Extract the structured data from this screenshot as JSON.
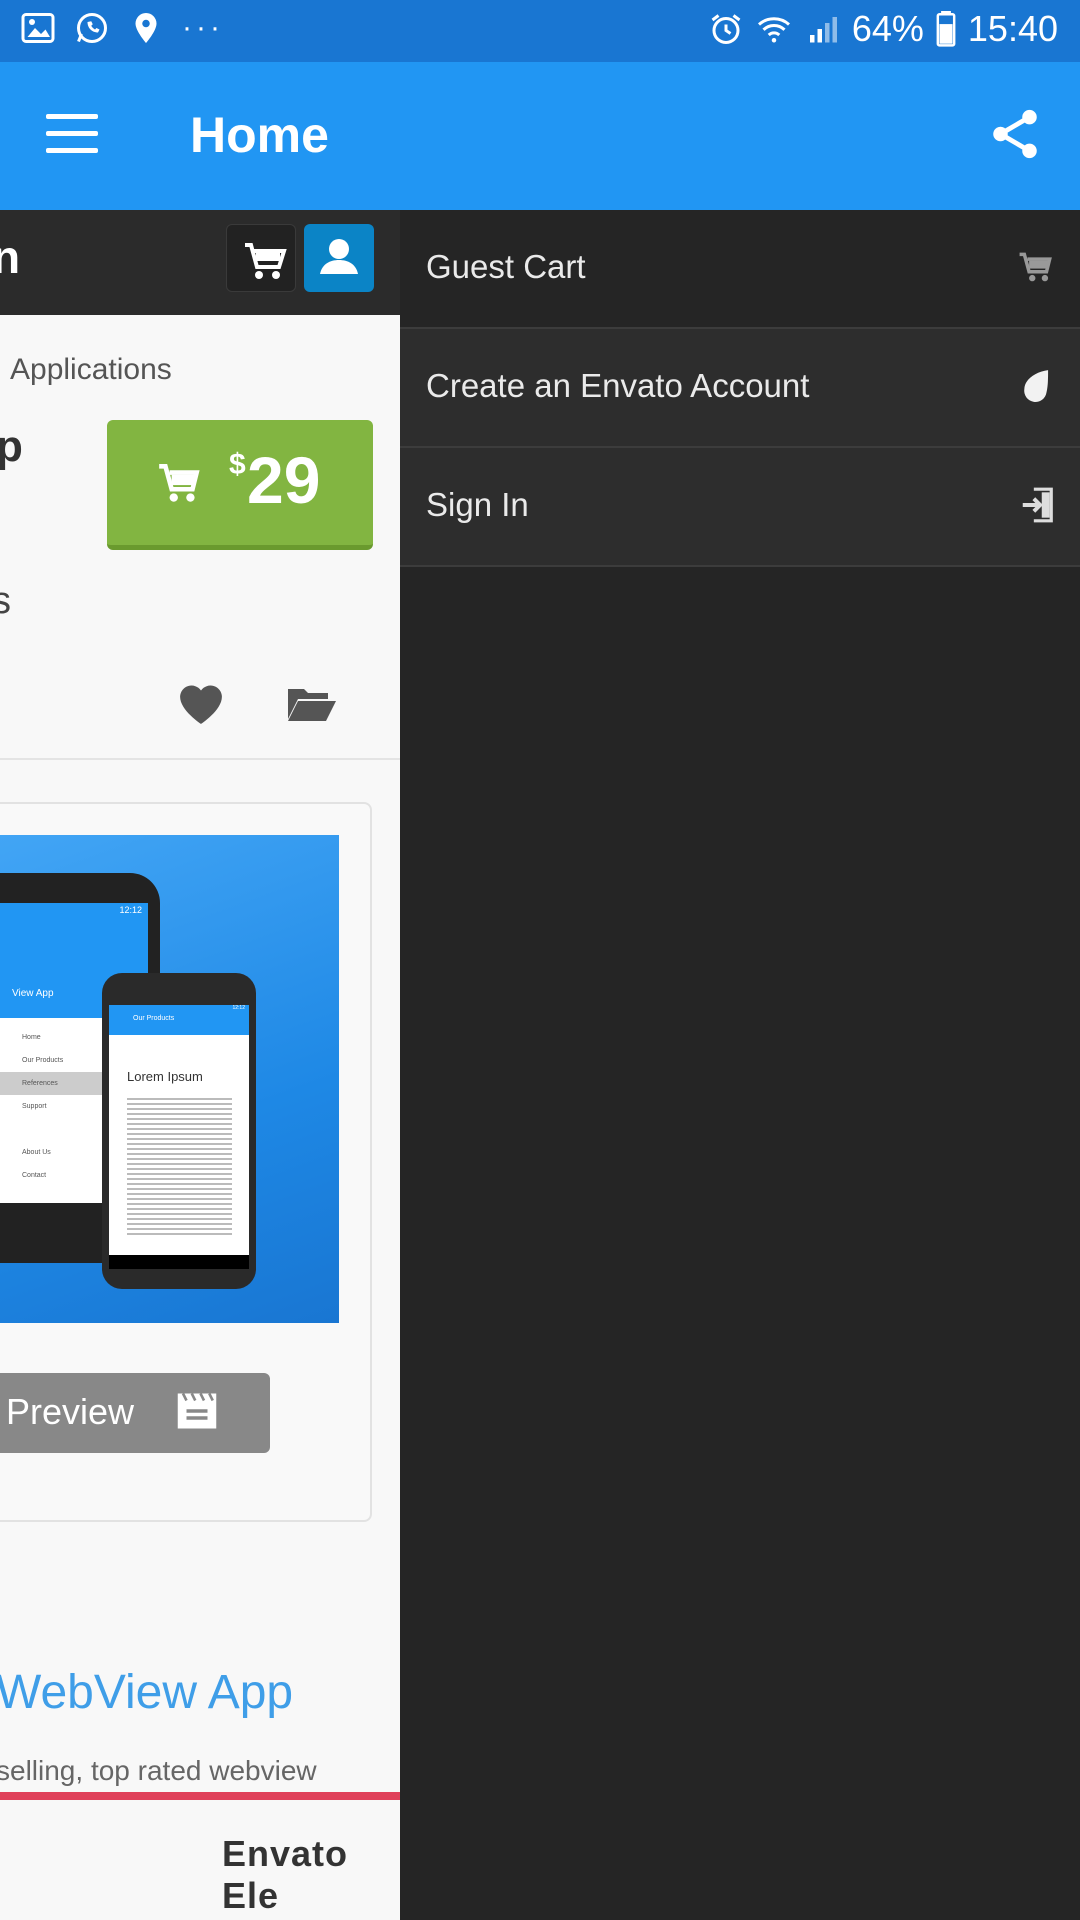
{
  "status_bar": {
    "battery": "64%",
    "time": "15:40",
    "left_icons": [
      "gallery-icon",
      "whatsapp-icon",
      "location-icon",
      "more-dots-icon"
    ],
    "more": "···",
    "right_icons": [
      "alarm-icon",
      "wifi-icon",
      "signal-icon",
      "battery-icon"
    ]
  },
  "appbar": {
    "title": "Home",
    "menu_icon": "hamburger-menu-icon",
    "share_icon": "share-icon"
  },
  "page": {
    "top_text": "n",
    "breadcrumb": "Applications",
    "title_fragment": "p",
    "price": {
      "currency": "$",
      "value": "29"
    },
    "sub_fragment": "s",
    "preview_label": "Preview",
    "webview_title": "WebView App",
    "webview_sub": "selling, top rated webview",
    "envato_fragment": "Envato Ele"
  },
  "screenshot_mock": {
    "back_phone": {
      "app_title": "View App",
      "time": "12:12",
      "menu": [
        "Home",
        "Our Products",
        "References",
        "Support",
        "About Us",
        "Contact"
      ]
    },
    "front_phone": {
      "bar_title": "Our Products",
      "time": "12:12",
      "heading": "Lorem Ipsum"
    }
  },
  "drawer": {
    "items": [
      {
        "label": "Guest Cart",
        "icon": "cart-icon"
      },
      {
        "label": "Create an Envato Account",
        "icon": "envato-leaf-icon"
      },
      {
        "label": "Sign In",
        "icon": "sign-in-icon"
      }
    ]
  },
  "colors": {
    "status_bar": "#1976d2",
    "app_bar": "#2196f3",
    "drawer_bg": "#252525",
    "price_button": "#82b541",
    "link_blue": "#3f9ee8",
    "accent_red": "#e0405a"
  }
}
